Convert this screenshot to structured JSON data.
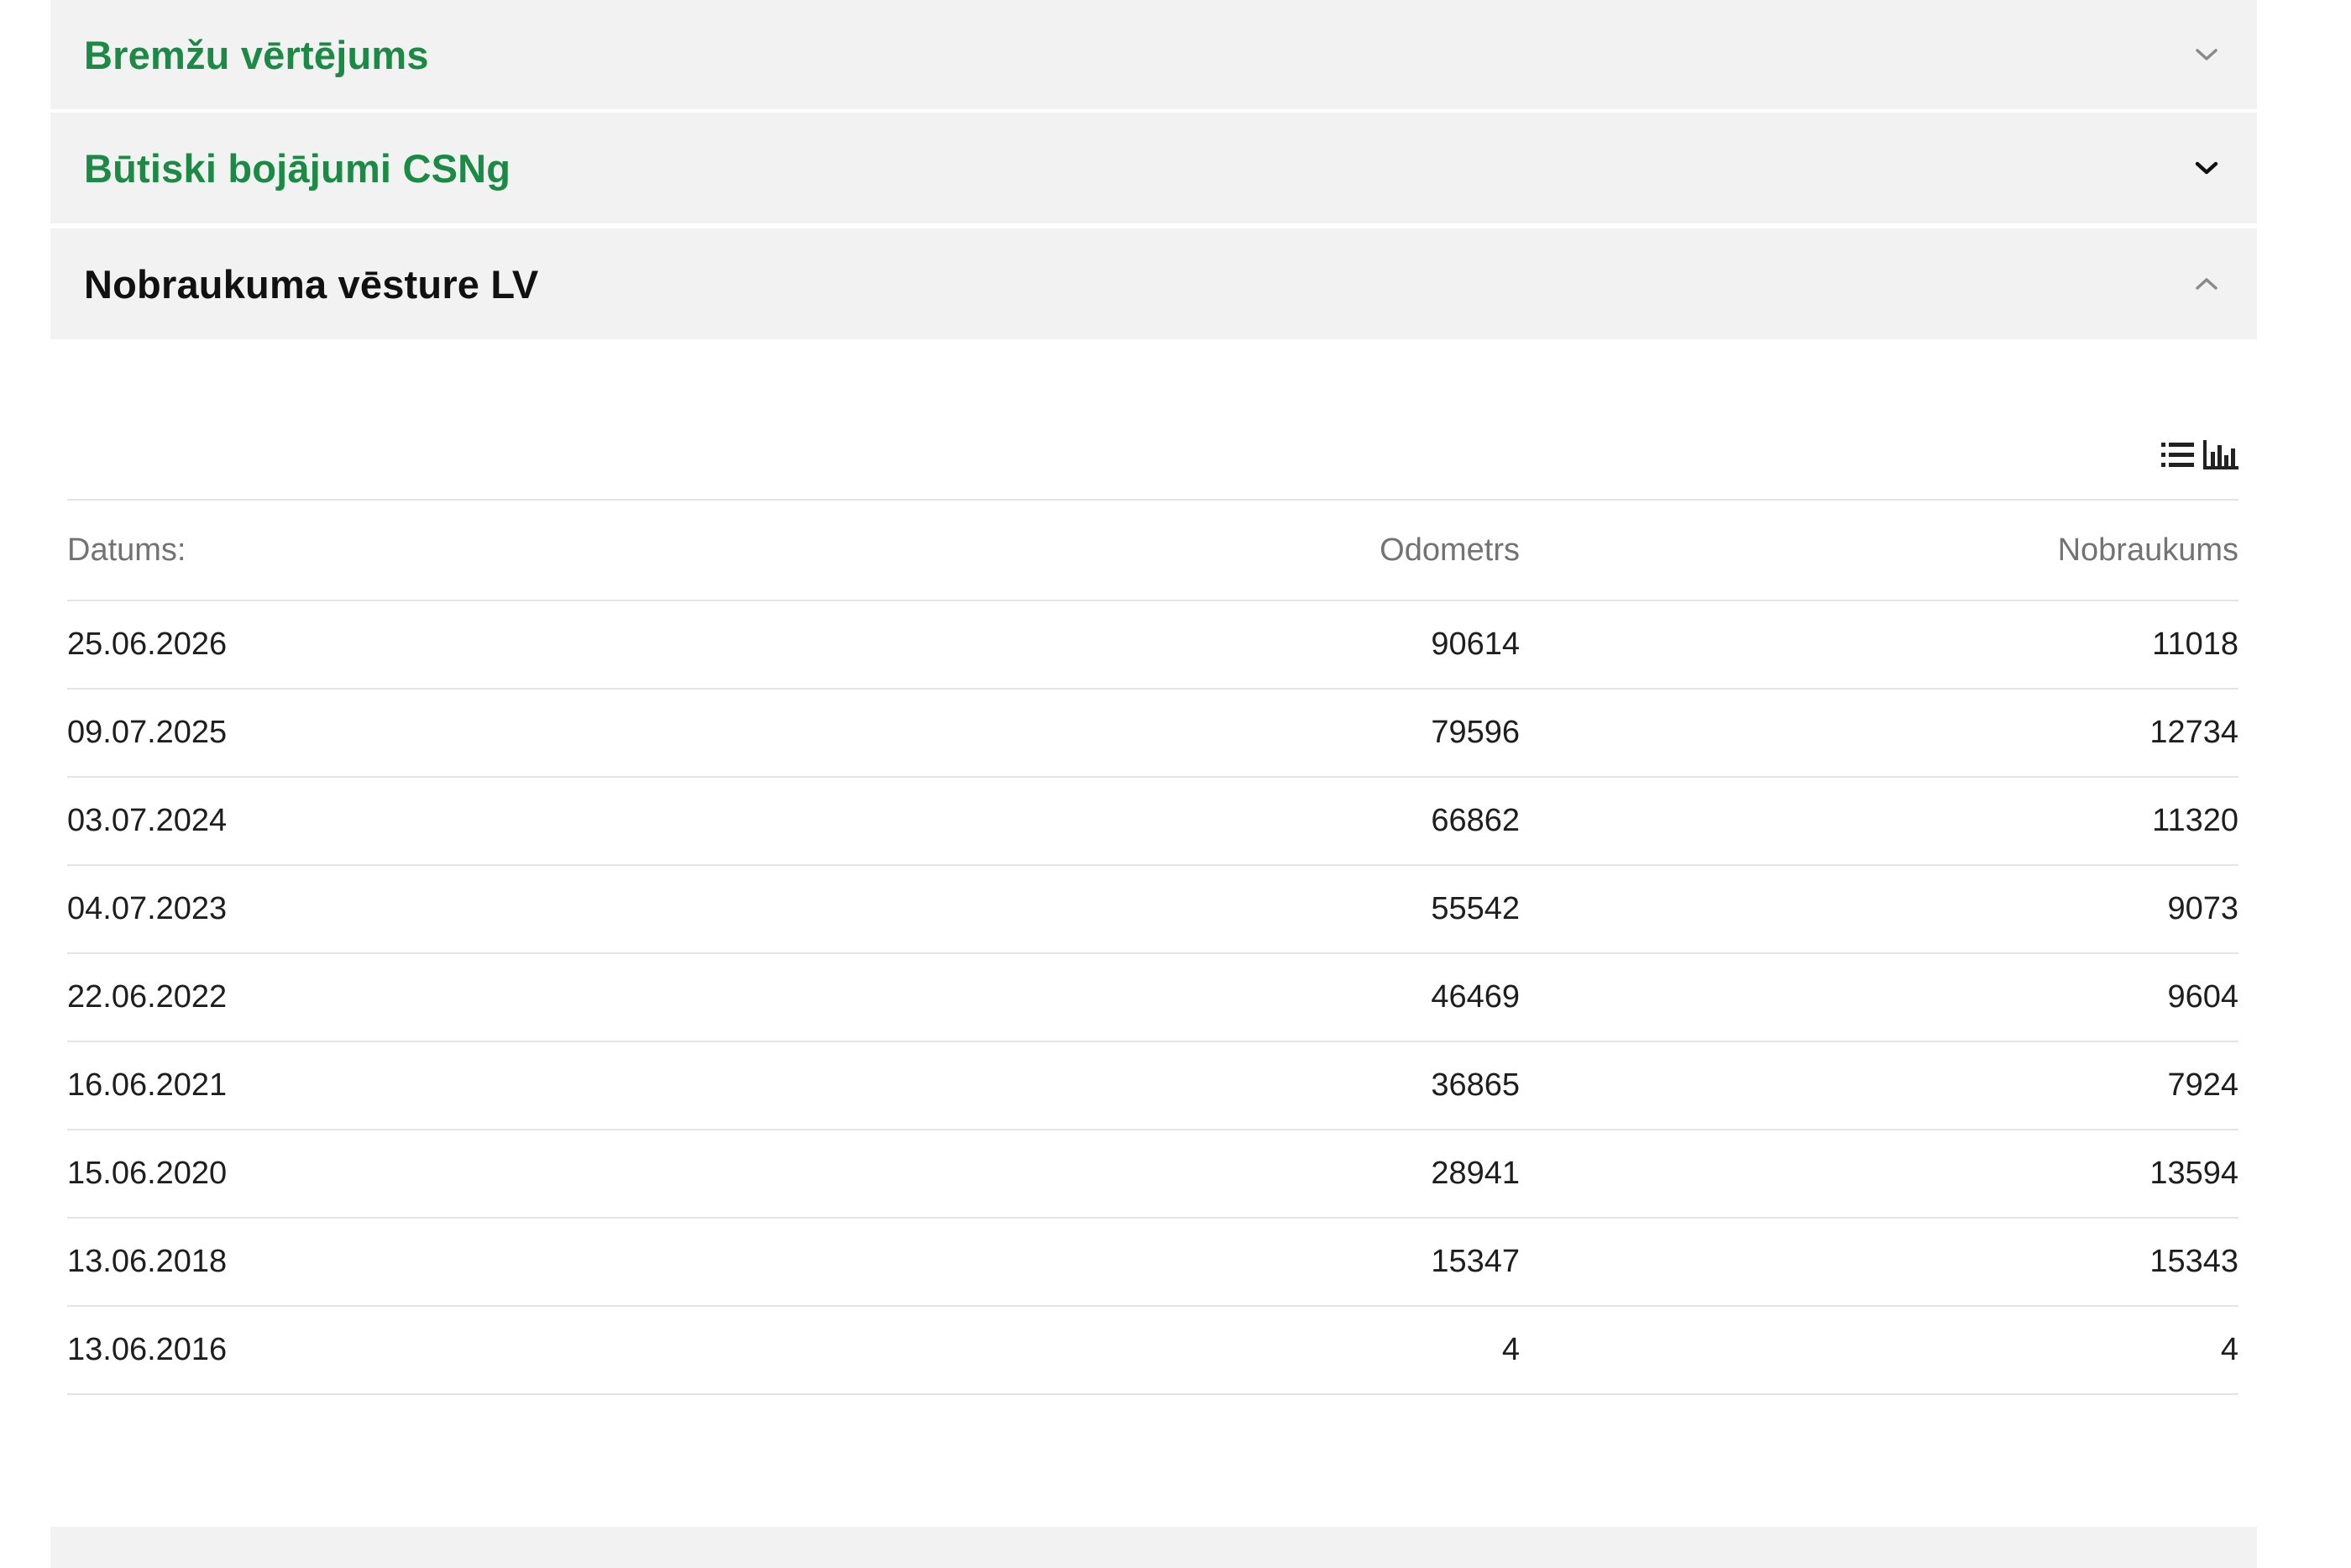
{
  "accordion": [
    {
      "title": "Bremžu vērtējums",
      "expanded": false
    },
    {
      "title": "Būtiski bojājumi CSNg",
      "expanded": false
    },
    {
      "title": "Nobraukuma vēsture LV",
      "expanded": true
    }
  ],
  "mileage_history": {
    "columns": {
      "date": "Datums:",
      "odometer": "Odometrs",
      "mileage": "Nobraukums"
    },
    "rows": [
      {
        "date": "25.06.2026",
        "odometer": "90614",
        "mileage": "11018"
      },
      {
        "date": "09.07.2025",
        "odometer": "79596",
        "mileage": "12734"
      },
      {
        "date": "03.07.2024",
        "odometer": "66862",
        "mileage": "11320"
      },
      {
        "date": "04.07.2023",
        "odometer": "55542",
        "mileage": "9073"
      },
      {
        "date": "22.06.2022",
        "odometer": "46469",
        "mileage": "9604"
      },
      {
        "date": "16.06.2021",
        "odometer": "36865",
        "mileage": "7924"
      },
      {
        "date": "15.06.2020",
        "odometer": "28941",
        "mileage": "13594"
      },
      {
        "date": "13.06.2018",
        "odometer": "15347",
        "mileage": "15343"
      },
      {
        "date": "13.06.2016",
        "odometer": "4",
        "mileage": "4"
      }
    ],
    "view_icons": [
      "list-view-icon",
      "chart-view-icon"
    ]
  },
  "colors": {
    "accent_green": "#1b8a45",
    "section_bg": "#f2f2f2",
    "divider": "#e4e4e4",
    "header_text": "#737373"
  }
}
